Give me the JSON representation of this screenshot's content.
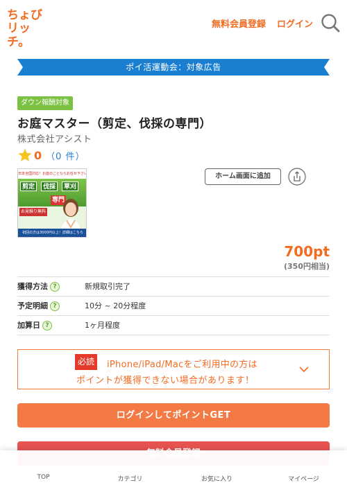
{
  "header": {
    "logo_line1": "ちょび",
    "logo_line2": "リッチ。",
    "register_label": "無料会員登録",
    "login_label": "ログイン",
    "search_icon": "search-icon",
    "brand_color": "#f26b21"
  },
  "banner": {
    "text": "ポイ活運動会：対象広告",
    "color": "#1a7fd1"
  },
  "product": {
    "tag": "ダウン報酬対象",
    "title": "お庭マスター（剪定、伐採の専門）",
    "company": "株式会社アシスト",
    "rating_score": "0",
    "review_open": "（",
    "review_count": "0 件",
    "review_close": "）",
    "home_add_label": "ホーム画面に追加",
    "share_icon": "share-icon",
    "points": "700pt",
    "points_yen": "(350円相当)",
    "ad": {
      "top_text": "日本全国対応！お庭のことならお任せ下さい",
      "chip1": "剪定",
      "chip2": "伐採",
      "chip3": "草刈",
      "chip4": "専門",
      "estimate": "お見積り無料",
      "bottom_text": "初回の方は3000円以上！詳細はこちら"
    }
  },
  "info": [
    {
      "label": "獲得方法",
      "help": "?",
      "value": "新規取引完了"
    },
    {
      "label": "予定明細",
      "help": "?",
      "value": "10分 ~ 20分程度"
    },
    {
      "label": "加算日",
      "help": "?",
      "value": "1ヶ月程度"
    }
  ],
  "notice": {
    "badge": "必読",
    "line1": "iPhone/iPad/Macをご利用中の方は",
    "line2": "ポイントが獲得できない場合があります！"
  },
  "cta": {
    "login_label": "ログインしてポイントGET",
    "register_label": "無料会員登録"
  },
  "bottom_nav": [
    {
      "label": "TOP",
      "icon": "home-icon"
    },
    {
      "label": "カテゴリ",
      "icon": "category-icon"
    },
    {
      "label": "お気に入り",
      "icon": "heart-icon"
    },
    {
      "label": "マイページ",
      "icon": "user-icon"
    }
  ]
}
